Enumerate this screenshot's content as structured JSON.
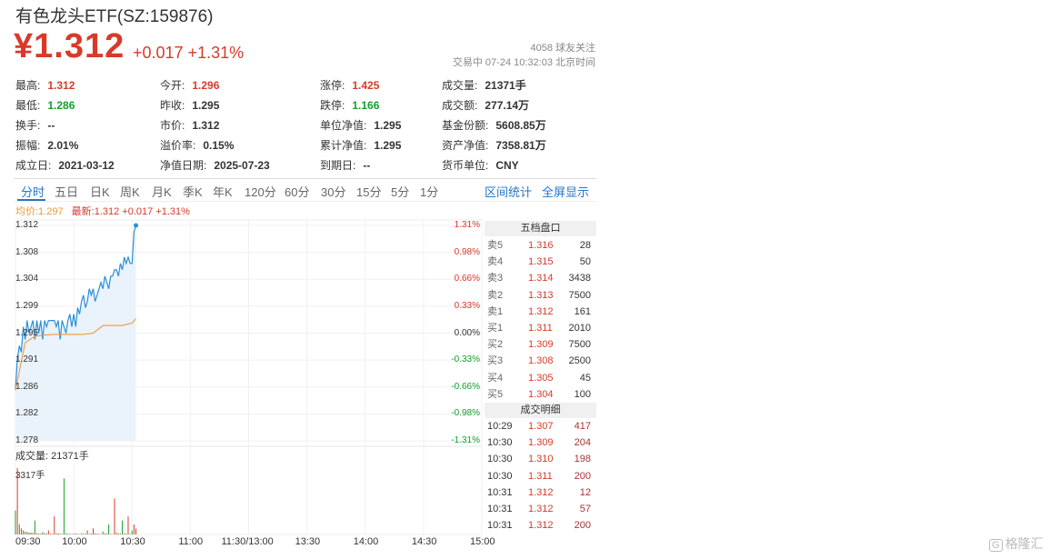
{
  "header": {
    "title": "有色龙头ETF(SZ:159876)",
    "price": "¥1.312",
    "change": "+0.017 +1.31%",
    "followers": "4058 球友关注",
    "status": "交易中 07-24 10:32:03 北京时间"
  },
  "stats": [
    [
      {
        "label": "最高:",
        "value": "1.312",
        "color": "red"
      },
      {
        "label": "今开:",
        "value": "1.296",
        "color": "red"
      },
      {
        "label": "涨停:",
        "value": "1.425",
        "color": "red"
      },
      {
        "label": "成交量:",
        "value": "21371手",
        "color": ""
      }
    ],
    [
      {
        "label": "最低:",
        "value": "1.286",
        "color": "green"
      },
      {
        "label": "昨收:",
        "value": "1.295",
        "color": ""
      },
      {
        "label": "跌停:",
        "value": "1.166",
        "color": "green"
      },
      {
        "label": "成交额:",
        "value": "277.14万",
        "color": ""
      }
    ],
    [
      {
        "label": "换手:",
        "value": "--",
        "color": ""
      },
      {
        "label": "市价:",
        "value": "1.312",
        "color": ""
      },
      {
        "label": "单位净值:",
        "value": "1.295",
        "color": ""
      },
      {
        "label": "基金份额:",
        "value": "5608.85万",
        "color": ""
      }
    ],
    [
      {
        "label": "振幅:",
        "value": "2.01%",
        "color": ""
      },
      {
        "label": "溢价率:",
        "value": "0.15%",
        "color": ""
      },
      {
        "label": "累计净值:",
        "value": "1.295",
        "color": ""
      },
      {
        "label": "资产净值:",
        "value": "7358.81万",
        "color": ""
      }
    ],
    [
      {
        "label": "成立日:",
        "value": "2021-03-12",
        "color": ""
      },
      {
        "label": "净值日期:",
        "value": "2025-07-23",
        "color": ""
      },
      {
        "label": "到期日:",
        "value": "--",
        "color": ""
      },
      {
        "label": "货币单位:",
        "value": "CNY",
        "color": ""
      }
    ]
  ],
  "tabs": [
    "分时",
    "五日",
    "日K",
    "周K",
    "月K",
    "季K",
    "年K",
    "120分",
    "60分",
    "30分",
    "15分",
    "5分",
    "1分"
  ],
  "active_tab": "分时",
  "tools": [
    "区间统计",
    "全屏显示"
  ],
  "legend": {
    "avg": "均价:1.297",
    "latest": "最新:1.312 +0.017 +1.31%"
  },
  "volume_label": "成交量: 21371手",
  "volume_max_label": "3317手",
  "order_book": {
    "title": "五档盘口",
    "asks": [
      [
        "卖5",
        "1.316",
        "28"
      ],
      [
        "卖4",
        "1.315",
        "50"
      ],
      [
        "卖3",
        "1.314",
        "3438"
      ],
      [
        "卖2",
        "1.313",
        "7500"
      ],
      [
        "卖1",
        "1.312",
        "161"
      ]
    ],
    "bids": [
      [
        "买1",
        "1.311",
        "2010"
      ],
      [
        "买2",
        "1.309",
        "7500"
      ],
      [
        "买3",
        "1.308",
        "2500"
      ],
      [
        "买4",
        "1.305",
        "45"
      ],
      [
        "买5",
        "1.304",
        "100"
      ]
    ],
    "trades_title": "成交明细",
    "trades": [
      [
        "10:29",
        "1.307",
        "417"
      ],
      [
        "10:30",
        "1.309",
        "204"
      ],
      [
        "10:30",
        "1.310",
        "198"
      ],
      [
        "10:30",
        "1.311",
        "200"
      ],
      [
        "10:31",
        "1.312",
        "12"
      ],
      [
        "10:31",
        "1.312",
        "57"
      ],
      [
        "10:31",
        "1.312",
        "200"
      ]
    ]
  },
  "watermark": "格隆汇",
  "chart_data": {
    "type": "line",
    "y_price_ticks": [
      "1.312",
      "1.308",
      "1.304",
      "1.299",
      "1.295",
      "1.291",
      "1.286",
      "1.282",
      "1.278"
    ],
    "y_pct_ticks": [
      "1.31%",
      "0.98%",
      "0.66%",
      "0.33%",
      "0.00%",
      "-0.33%",
      "-0.66%",
      "-0.98%",
      "-1.31%"
    ],
    "x_ticks": [
      "09:30",
      "10:00",
      "10:30",
      "11:00",
      "11:30/13:00",
      "13:30",
      "14:00",
      "14:30",
      "15:00"
    ],
    "ylim": [
      1.278,
      1.312
    ],
    "x_minutes_total": 240,
    "price_series": {
      "minutes": [
        0,
        1,
        2,
        3,
        4,
        5,
        6,
        7,
        8,
        9,
        10,
        11,
        12,
        13,
        14,
        15,
        16,
        17,
        18,
        19,
        20,
        21,
        22,
        23,
        24,
        25,
        26,
        27,
        28,
        29,
        30,
        31,
        32,
        33,
        34,
        35,
        36,
        37,
        38,
        39,
        40,
        41,
        42,
        43,
        44,
        45,
        46,
        47,
        48,
        49,
        50,
        51,
        52,
        53,
        54,
        55,
        56,
        57,
        58,
        59,
        60,
        61,
        62
      ],
      "values": [
        1.286,
        1.291,
        1.293,
        1.292,
        1.296,
        1.294,
        1.297,
        1.295,
        1.296,
        1.297,
        1.294,
        1.297,
        1.295,
        1.297,
        1.294,
        1.297,
        1.296,
        1.297,
        1.297,
        1.297,
        1.297,
        1.296,
        1.297,
        1.294,
        1.297,
        1.296,
        1.295,
        1.297,
        1.298,
        1.296,
        1.298,
        1.296,
        1.299,
        1.298,
        1.3,
        1.301,
        1.299,
        1.3,
        1.302,
        1.301,
        1.302,
        1.3,
        1.301,
        1.302,
        1.303,
        1.302,
        1.304,
        1.303,
        1.302,
        1.304,
        1.304,
        1.305,
        1.305,
        1.304,
        1.306,
        1.305,
        1.307,
        1.306,
        1.307,
        1.306,
        1.306,
        1.311,
        1.312
      ]
    },
    "avg_series": {
      "minutes": [
        0,
        5,
        10,
        15,
        20,
        25,
        30,
        35,
        40,
        45,
        50,
        55,
        60,
        62
      ],
      "values": [
        1.286,
        1.2935,
        1.2945,
        1.2947,
        1.2948,
        1.2948,
        1.2948,
        1.2948,
        1.295,
        1.2962,
        1.2962,
        1.2962,
        1.2966,
        1.2973
      ]
    },
    "volume_series": {
      "minutes": [
        0,
        1,
        2,
        3,
        4,
        5,
        6,
        7,
        8,
        9,
        10,
        11,
        12,
        13,
        14,
        15,
        16,
        17,
        18,
        19,
        20,
        21,
        22,
        23,
        24,
        25,
        26,
        27,
        28,
        29,
        30,
        31,
        32,
        33,
        34,
        35,
        36,
        37,
        38,
        39,
        40,
        41,
        42,
        43,
        44,
        45,
        46,
        47,
        48,
        49,
        50,
        51,
        52,
        53,
        54,
        55,
        56,
        57,
        58,
        59,
        60,
        61,
        62
      ],
      "values": [
        1200,
        3317,
        500,
        300,
        200,
        150,
        120,
        100,
        90,
        80,
        700,
        60,
        50,
        40,
        120,
        60,
        50,
        200,
        40,
        30,
        900,
        50,
        60,
        40,
        30,
        2800,
        60,
        40,
        30,
        20,
        40,
        50,
        30,
        20,
        60,
        30,
        40,
        200,
        30,
        50,
        300,
        60,
        40,
        30,
        20,
        150,
        60,
        40,
        500,
        30,
        20,
        1800,
        80,
        60,
        40,
        700,
        50,
        40,
        900,
        30,
        200,
        500,
        300
      ]
    },
    "volume_directions": [
      "down",
      "up",
      "up",
      "down",
      "up",
      "down",
      "up",
      "down",
      "up",
      "up",
      "down",
      "up",
      "down",
      "up",
      "down",
      "up",
      "down",
      "up",
      "up",
      "up",
      "up",
      "down",
      "up",
      "down",
      "up",
      "down",
      "down",
      "up",
      "up",
      "down",
      "up",
      "down",
      "up",
      "down",
      "up",
      "up",
      "down",
      "up",
      "up",
      "down",
      "up",
      "down",
      "up",
      "up",
      "up",
      "down",
      "up",
      "down",
      "down",
      "up",
      "up",
      "up",
      "up",
      "down",
      "up",
      "down",
      "up",
      "down",
      "up",
      "down",
      "down",
      "up",
      "up"
    ],
    "colors": {
      "price_line": "#2b8fd9",
      "avg_line": "#f0a050",
      "fill": "#eaf3fb",
      "up": "#d83a2a",
      "down": "#13a02c",
      "pct_up": "#d83a2a",
      "pct_down": "#13a02c",
      "pct_zero": "#333333"
    }
  }
}
